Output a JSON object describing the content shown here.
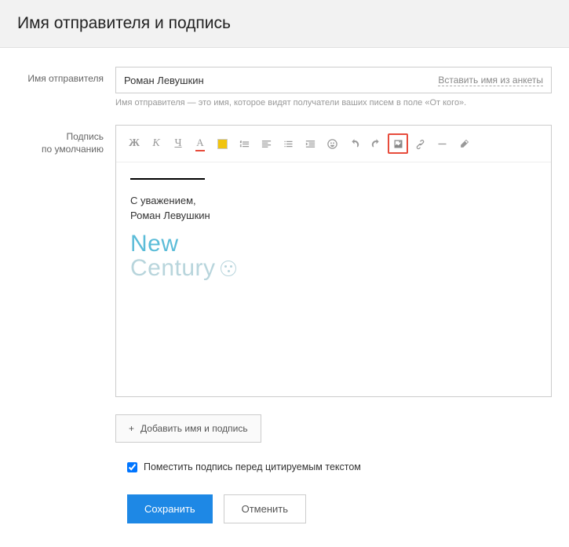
{
  "header": {
    "title": "Имя отправителя и подпись"
  },
  "sender": {
    "label": "Имя отправителя",
    "value": "Роман Левушкин",
    "insert_link": "Вставить имя из анкеты",
    "hint": "Имя отправителя — это имя, которое видят получатели ваших писем в поле «От кого»."
  },
  "signature": {
    "label_line1": "Подпись",
    "label_line2": "по умолчанию",
    "greeting": "С уважением,",
    "name": "Роман Левушкин",
    "logo_top": "New",
    "logo_bottom": "Century"
  },
  "toolbar": {
    "bold": "Ж",
    "italic": "К",
    "underline": "Ч",
    "strike": "А"
  },
  "add_button": "Добавить имя и подпись",
  "checkbox": {
    "checked": true,
    "label": "Поместить подпись перед цитируемым текстом"
  },
  "actions": {
    "save": "Сохранить",
    "cancel": "Отменить"
  }
}
